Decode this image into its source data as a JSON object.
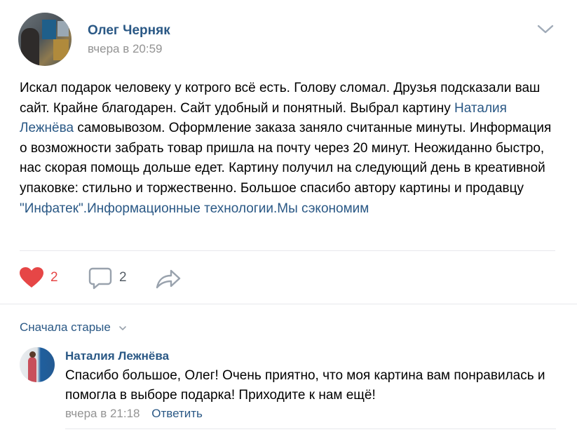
{
  "post": {
    "author": "Олег Черняк",
    "time": "вчера в 20:59",
    "text_parts": {
      "p1": "Искал подарок человеку у котрого всё есть. Голову сломал. Друзья подсказали ваш сайт. Крайне благодарен. Сайт удобный и понятный. Выбрал картину ",
      "link1": "Наталия Лежнёва",
      "p2": " самовывозом. Оформление заказа заняло считанные минуты. Информация о возможности забрать товар пришла на почту через 20 минут. Неожиданно быстро, нас скорая помощь дольше едет. Картину получил на следующий день в креативной упаковке: стильно и торжественно. Большое спасибо автору картины и продавцу ",
      "link2": "\"Инфатек\".Информационные технологии.Мы сэкономим"
    }
  },
  "actions": {
    "likes": "2",
    "comments": "2",
    "like_color": "#e64646"
  },
  "comments_section": {
    "sort_label": "Сначала старые"
  },
  "comment": {
    "author": "Наталия Лежнёва",
    "text": "Спасибо большое, Олег! Очень приятно, что моя картина вам понравилась и помогла в выборе подарка! Приходите к нам ещё!",
    "time": "вчера в 21:18",
    "reply_label": "Ответить"
  },
  "colors": {
    "link": "#2a5885",
    "muted": "#939393",
    "separator": "#e7e8ec"
  }
}
